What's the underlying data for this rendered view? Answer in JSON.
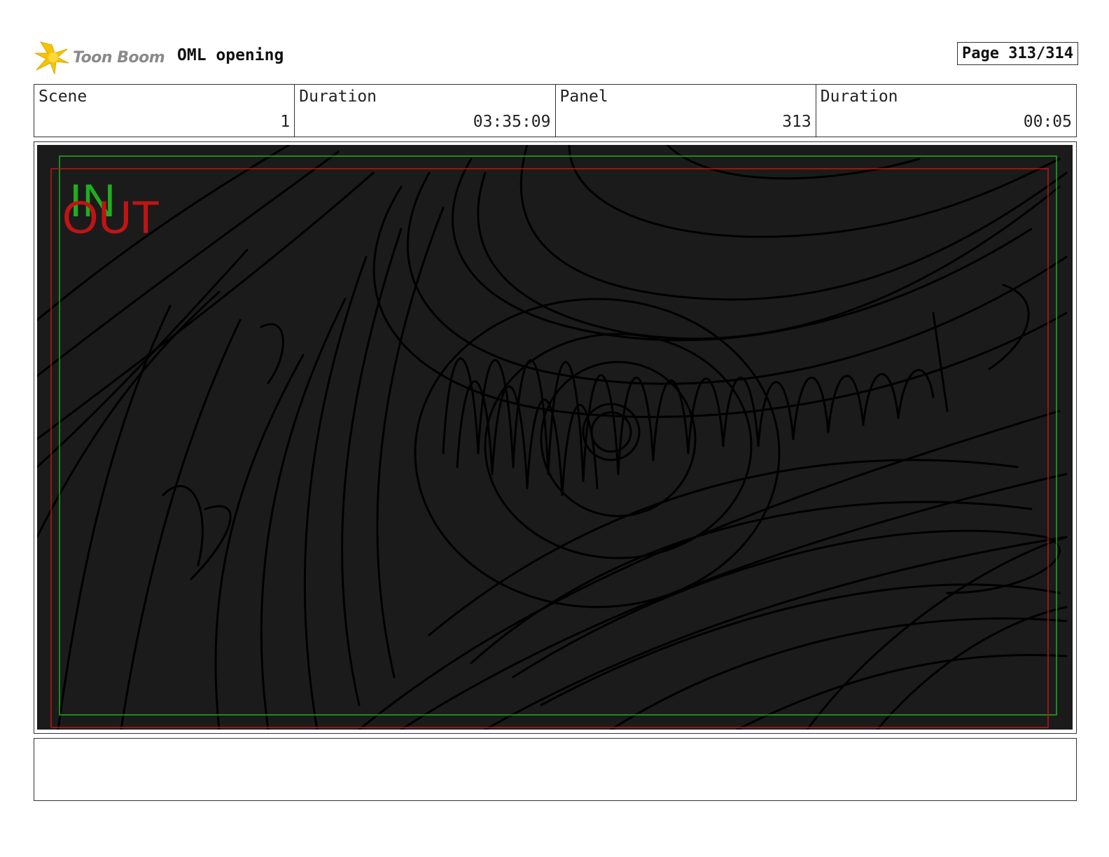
{
  "header": {
    "logo_text": "Toon Boom",
    "project_title": "OML opening",
    "page_label": "Page 313/314"
  },
  "info": {
    "scene_label": "Scene",
    "scene_value": "1",
    "scene_duration_label": "Duration",
    "scene_duration_value": "03:35:09",
    "panel_label": "Panel",
    "panel_value": "313",
    "panel_duration_label": "Duration",
    "panel_duration_value": "00:05"
  },
  "frame": {
    "in_label": "IN",
    "out_label": "OUT",
    "in_color": "#1fae1f",
    "out_color": "#c01414",
    "background_color": "#1b1b1b",
    "sketch_color": "#000000"
  },
  "notes": {
    "text": ""
  },
  "icons": {
    "logo": "toon-boom-star-icon"
  }
}
